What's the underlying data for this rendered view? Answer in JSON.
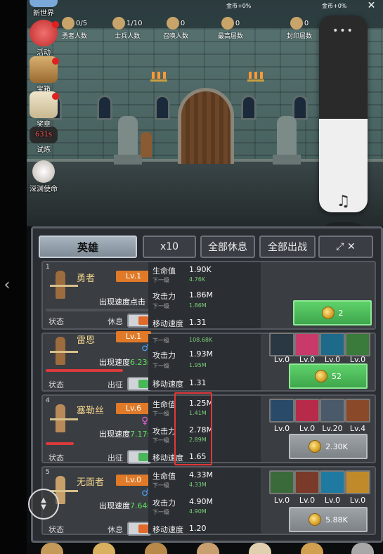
{
  "top": {
    "gold_rate_left": "金币+0%",
    "gold_rate_right": "金币+0%",
    "stats": [
      {
        "value": "0/5",
        "label": "勇者人数",
        "icon": "hero-icon"
      },
      {
        "value": "1/10",
        "label": "士兵人数",
        "icon": "soldier-icon"
      },
      {
        "value": "0",
        "label": "召唤人数",
        "icon": "summon-icon"
      },
      {
        "value": "0",
        "label": "最高层数",
        "icon": "floor-icon"
      },
      {
        "value": "0",
        "label": "封印层数",
        "icon": "seal-icon"
      }
    ]
  },
  "side_menu": [
    {
      "label": "新世界",
      "icon": "globe-icon"
    },
    {
      "label": "活动",
      "icon": "heart-icon"
    },
    {
      "label": "宝箱",
      "icon": "chest-icon"
    },
    {
      "label": "奖章",
      "icon": "scroll-icon"
    },
    {
      "label": "试炼",
      "icon": "trial-icon",
      "timer": "631s"
    },
    {
      "label": "深渊使命",
      "icon": "pearl-icon"
    }
  ],
  "tabs": {
    "hero": "英雄",
    "x10": "x10",
    "rest_all": "全部休息",
    "deploy_all": "全部出战"
  },
  "labels": {
    "hp": "生命值",
    "next": "下一级",
    "atk": "攻击力",
    "move": "移动速度",
    "status": "状态",
    "speed_prefix": "出现速度"
  },
  "heroes": [
    {
      "num": "1",
      "name": "勇者",
      "level": "Lv.1",
      "appear": "出现速度点击",
      "state": "休息",
      "hp": "1.90K",
      "hp_next": "4.76K",
      "atk": "1.86M",
      "atk_next": "1.86M",
      "move": "1.31",
      "cost": "2",
      "cost_style": "green"
    },
    {
      "num": "",
      "name": "雷恩",
      "level": "Lv.1",
      "appear_value": "6.23s",
      "state": "出征",
      "hp": "",
      "hp_next": "108.68K",
      "atk": "1.93M",
      "atk_next": "1.95M",
      "move": "1.31",
      "cost": "52",
      "cost_style": "green",
      "equip_levels": [
        "Lv.0",
        "Lv.0",
        "Lv.0",
        "Lv.0"
      ]
    },
    {
      "num": "4",
      "name": "塞勒丝",
      "level": "Lv.6",
      "appear_value": "7.17s",
      "state": "出征",
      "hp": "1.25M",
      "hp_next": "1.41M",
      "atk": "2.78M",
      "atk_next": "2.89M",
      "move": "1.65",
      "cost": "2.30K",
      "cost_style": "grey",
      "equip_levels": [
        "Lv.0",
        "Lv.0",
        "Lv.20",
        "Lv.4"
      ]
    },
    {
      "num": "5",
      "name": "无面者",
      "level": "Lv.0",
      "appear_value": "7.64s",
      "state": "休息",
      "hp": "4.33M",
      "hp_next": "4.33M",
      "atk": "4.90M",
      "atk_next": "4.90M",
      "move": "1.20",
      "cost": "5.88K",
      "cost_style": "grey",
      "equip_levels": [
        "Lv.0",
        "Lv.0",
        "Lv.0",
        "Lv.0"
      ]
    }
  ],
  "colors": {
    "accent_orange": "#e07a28",
    "upgrade_green": "#4bb55a",
    "highlight_red": "#e0383a"
  }
}
